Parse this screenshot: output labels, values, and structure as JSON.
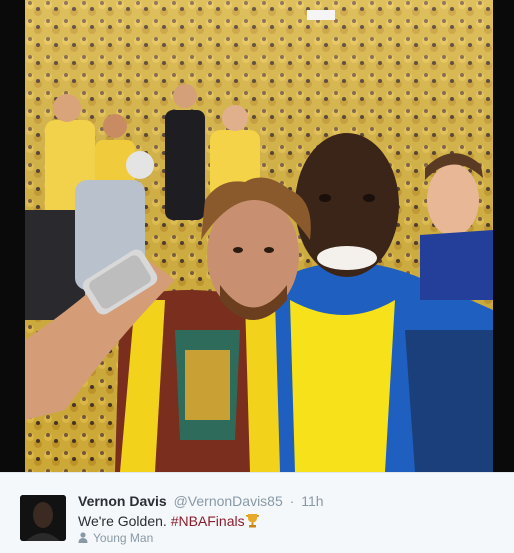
{
  "tweet": {
    "display_name": "Vernon Davis",
    "screen_name": "@VernonDavis85",
    "separator": "·",
    "timestamp": "11h",
    "text": "We're Golden.",
    "hashtag": "#NBAFinals",
    "location": "Young Man"
  },
  "icons": {
    "trophy": "trophy-icon",
    "person": "person-icon"
  },
  "colors": {
    "hashtag": "#8b1d2c",
    "meta_text": "#8899a6",
    "name_text": "#292f33",
    "panel_bg": "#f5f8fa"
  }
}
